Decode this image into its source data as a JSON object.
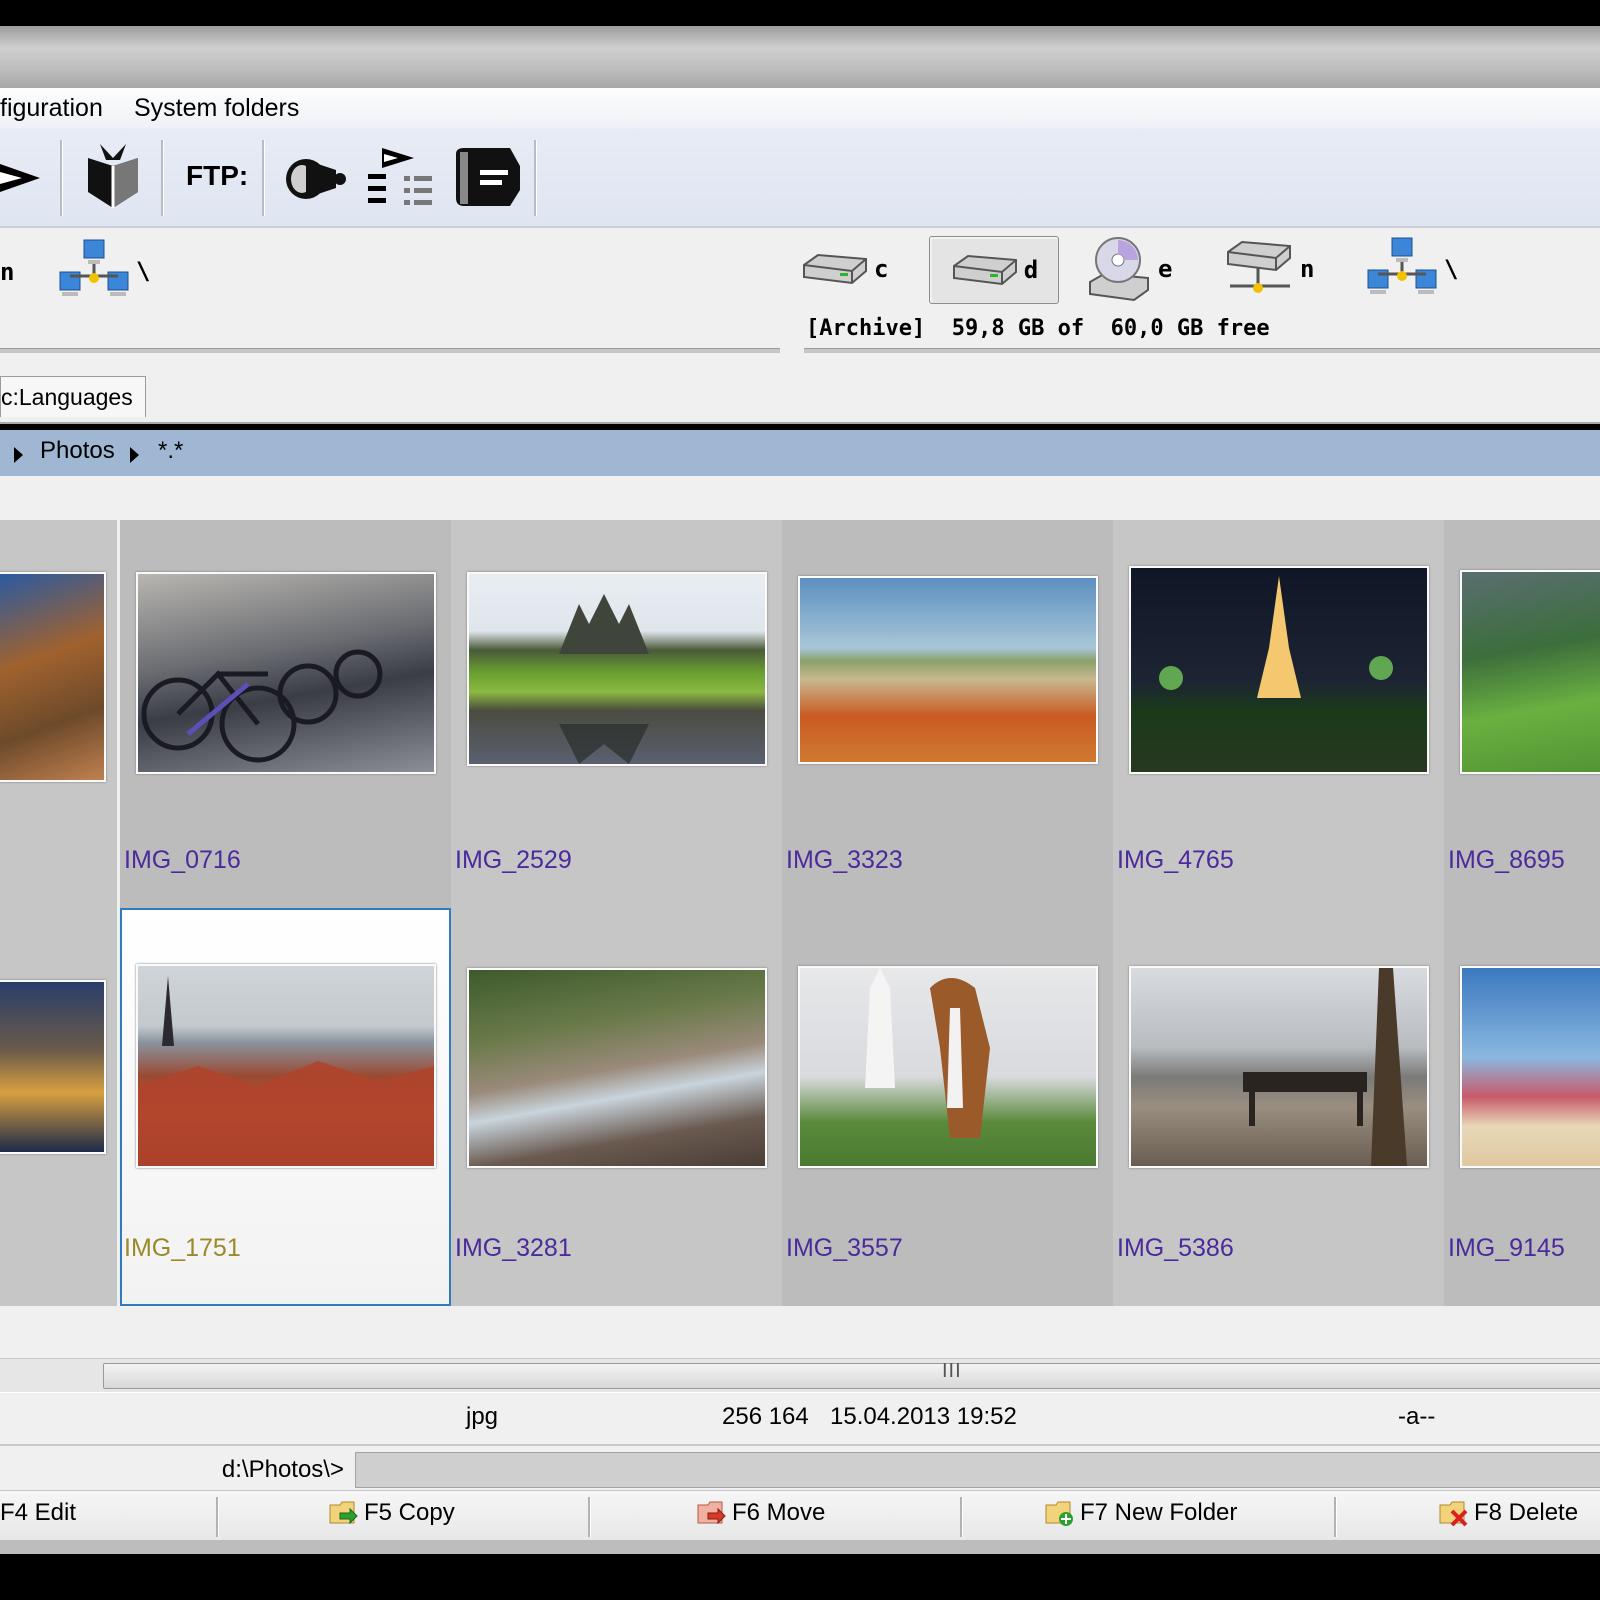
{
  "menu": {
    "items": [
      "figuration",
      "System folders"
    ]
  },
  "toolbar": {
    "ftp_label": "FTP:"
  },
  "left_drives": {
    "partial_label": "n",
    "network_label": "\\"
  },
  "right_drives": {
    "items": [
      {
        "letter": "c",
        "icon": "hard-drive-icon",
        "active": false
      },
      {
        "letter": "d",
        "icon": "hard-drive-icon",
        "active": true
      },
      {
        "letter": "e",
        "icon": "cd-drive-icon",
        "active": false
      },
      {
        "letter": "n",
        "icon": "network-drive-icon",
        "active": false
      },
      {
        "letter": "\\",
        "icon": "network-icon",
        "active": false
      }
    ],
    "info": "[Archive]  59,8 GB of  60,0 GB free"
  },
  "tabs": {
    "current": "c:Languages"
  },
  "path": {
    "folder": "Photos",
    "filter": "*.*"
  },
  "thumbnails": {
    "row1": [
      "",
      "IMG_0716",
      "IMG_2529",
      "IMG_3323",
      "IMG_4765",
      "IMG_8695"
    ],
    "row2": [
      "",
      "IMG_1751",
      "IMG_3281",
      "IMG_3557",
      "IMG_5386",
      "IMG_9145"
    ],
    "selected": "IMG_1751"
  },
  "scrollbar": {
    "grip": "III"
  },
  "status": {
    "ext": "jpg",
    "size": "256 164",
    "date": "15.04.2013 19:52",
    "attr": "-a--"
  },
  "command": {
    "path": "d:\\Photos\\>",
    "value": ""
  },
  "fkeys": {
    "f4": "F4 Edit",
    "f5": "F5 Copy",
    "f6": "F6 Move",
    "f7": "F7 New Folder",
    "f8": "F8 Delete"
  },
  "colors": {
    "caption": "#4b2a9c",
    "selected_caption": "#9a8a2a",
    "path_bar": "#9fb7d3",
    "selection_border": "#2f7bc1"
  }
}
